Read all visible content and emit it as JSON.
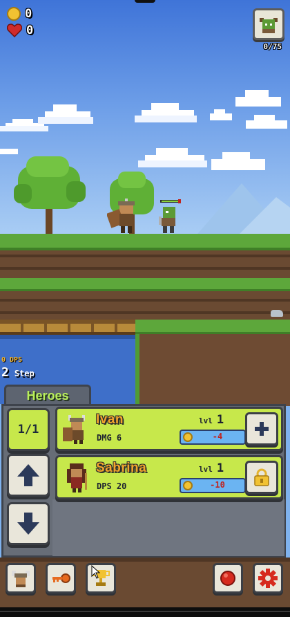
{
  "hud": {
    "coins": "0",
    "lives": "0",
    "enemy_progress": "0/75"
  },
  "battle": {
    "dps": "0 DPS",
    "step_number": "2",
    "step_label": "Step"
  },
  "heroes_panel": {
    "tab_label": "Heroes",
    "count_label": "1/1",
    "heroes": [
      {
        "name": "Ivan",
        "stat": "DMG 6",
        "level_label": "lvl",
        "level": "1",
        "cost": "-4",
        "action": "add",
        "locked": false
      },
      {
        "name": "Sabrina",
        "stat": "DPS 20",
        "level_label": "lvl",
        "level": "1",
        "cost": "-10",
        "action": "lock",
        "locked": true
      }
    ]
  },
  "bottom_bar": {
    "left_buttons": [
      "hero-portrait-icon",
      "key-icon",
      "trophy-icon"
    ],
    "right_buttons": [
      "record-icon",
      "settings-gear-icon"
    ]
  },
  "colors": {
    "accent_lime": "#c7e84b",
    "name_orange": "#f3a52c",
    "tab_text_green": "#b9f05a",
    "cost_red": "#c0241f",
    "coin_gold": "#f1c232",
    "heart_red": "#d12b2b",
    "panel_gray": "#676d77"
  }
}
